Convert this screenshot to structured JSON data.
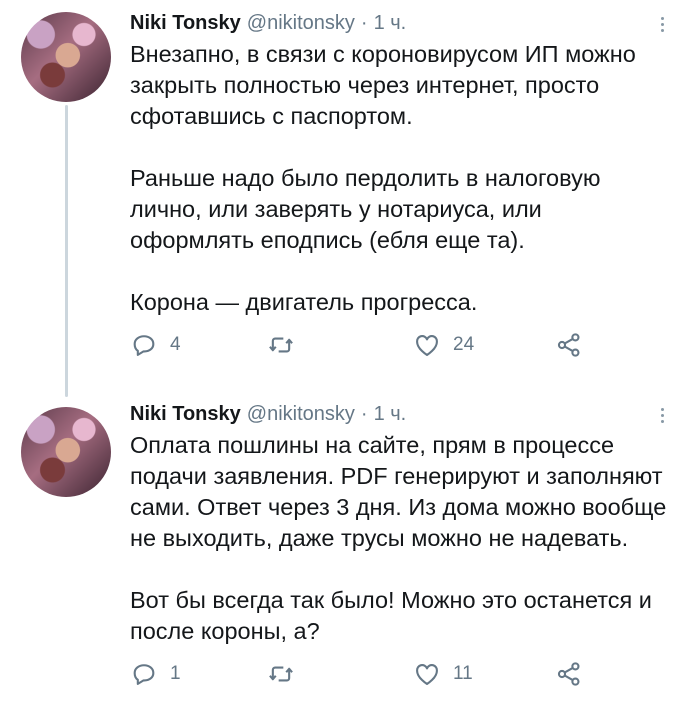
{
  "tweets": [
    {
      "name": "Niki Tonsky",
      "handle": "@nikitonsky",
      "dot": "·",
      "time": "1 ч.",
      "paragraphs": [
        "Внезапно, в связи с короновирусом ИП можно закрыть полностью через интернет, просто сфотавшись с паспортом.",
        "Раньше надо было пердолить в налоговую лично, или заверять у нотариуса, или оформлять еподпись (ебля еще та).",
        "Корона — двигатель прогресса."
      ],
      "replies": "4",
      "likes": "24"
    },
    {
      "name": "Niki Tonsky",
      "handle": "@nikitonsky",
      "dot": "·",
      "time": "1 ч.",
      "paragraphs": [
        "Оплата пошлины на сайте, прям в процессе подачи заявления. PDF генерируют и заполняют сами. Ответ через 3 дня. Из дома можно вообще не выходить, даже трусы можно не надевать.",
        "Вот бы всегда так было! Можно это останется и после короны, а?"
      ],
      "replies": "1",
      "likes": "11"
    }
  ],
  "icons": {
    "reply": "reply-icon",
    "retweet": "retweet-icon",
    "like": "heart-icon",
    "share": "share-icon",
    "more": "more-vertical-icon"
  },
  "colors": {
    "text": "#14171a",
    "muted": "#657786",
    "thread_line": "#ccd6dd"
  }
}
